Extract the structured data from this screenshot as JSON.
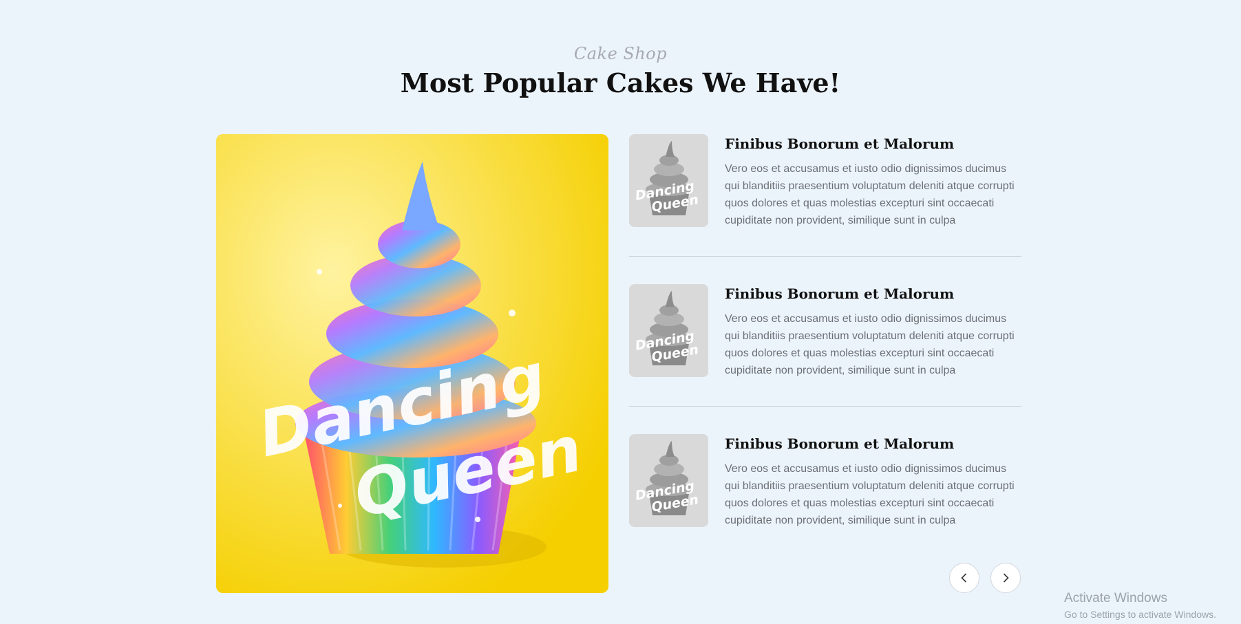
{
  "header": {
    "subtitle": "Cake Shop",
    "title": "Most Popular Cakes We Have!"
  },
  "hero_image": {
    "description_icon": "cupcake-image",
    "overlay_text_line1": "Dancing",
    "overlay_text_line2": "Queen",
    "background_color": "#ffdd00"
  },
  "items": [
    {
      "title": "Finibus Bonorum et Malorum",
      "description": "Vero eos et accusamus et iusto odio dignissimos ducimus qui blanditiis praesentium voluptatum deleniti atque corrupti quos dolores et quas molestias excepturi sint occaecati cupiditate non provident, similique sunt in culpa",
      "thumb_text_line1": "Dancing",
      "thumb_text_line2": "Queen"
    },
    {
      "title": "Finibus Bonorum et Malorum",
      "description": "Vero eos et accusamus et iusto odio dignissimos ducimus qui blanditiis praesentium voluptatum deleniti atque corrupti quos dolores et quas molestias excepturi sint occaecati cupiditate non provident, similique sunt in culpa",
      "thumb_text_line1": "Dancing",
      "thumb_text_line2": "Queen"
    },
    {
      "title": "Finibus Bonorum et Malorum",
      "description": "Vero eos et accusamus et iusto odio dignissimos ducimus qui blanditiis praesentium voluptatum deleniti atque corrupti quos dolores et quas molestias excepturi sint occaecati cupiditate non provident, similique sunt in culpa",
      "thumb_text_line1": "Dancing",
      "thumb_text_line2": "Queen"
    }
  ],
  "navigation": {
    "prev_icon": "chevron-left-icon",
    "next_icon": "chevron-right-icon"
  },
  "watermark": {
    "line1": "Activate Windows",
    "line2": "Go to Settings to activate Windows."
  },
  "colors": {
    "background": "#ecf4fb",
    "accent_yellow": "#ffdd00"
  }
}
